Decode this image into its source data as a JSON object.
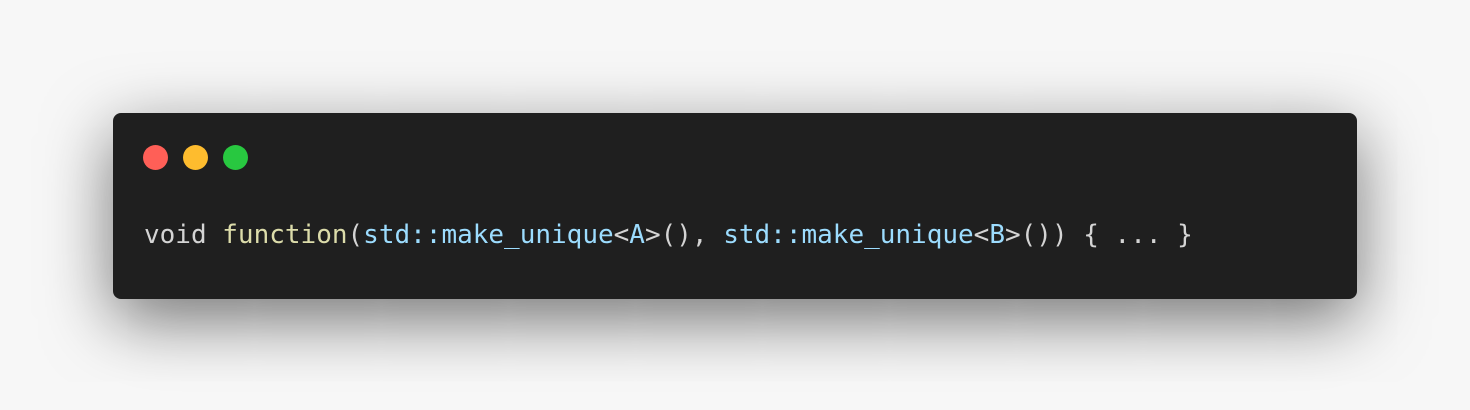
{
  "window": {
    "controls": [
      {
        "name": "close",
        "color": "#ff5f57"
      },
      {
        "name": "minimize",
        "color": "#febc2e"
      },
      {
        "name": "zoom",
        "color": "#28c840"
      }
    ]
  },
  "code": {
    "tokens": [
      {
        "text": "void ",
        "color": "#d4d4d4"
      },
      {
        "text": "function",
        "color": "#dcdcaa"
      },
      {
        "text": "(",
        "color": "#d4d4d4"
      },
      {
        "text": "std::make_unique",
        "color": "#9cdcfe"
      },
      {
        "text": "<",
        "color": "#d4d4d4"
      },
      {
        "text": "A",
        "color": "#9cdcfe"
      },
      {
        "text": ">(), ",
        "color": "#d4d4d4"
      },
      {
        "text": "std::make_unique",
        "color": "#9cdcfe"
      },
      {
        "text": "<",
        "color": "#d4d4d4"
      },
      {
        "text": "B",
        "color": "#9cdcfe"
      },
      {
        "text": ">()) { ... }",
        "color": "#d4d4d4"
      }
    ]
  }
}
